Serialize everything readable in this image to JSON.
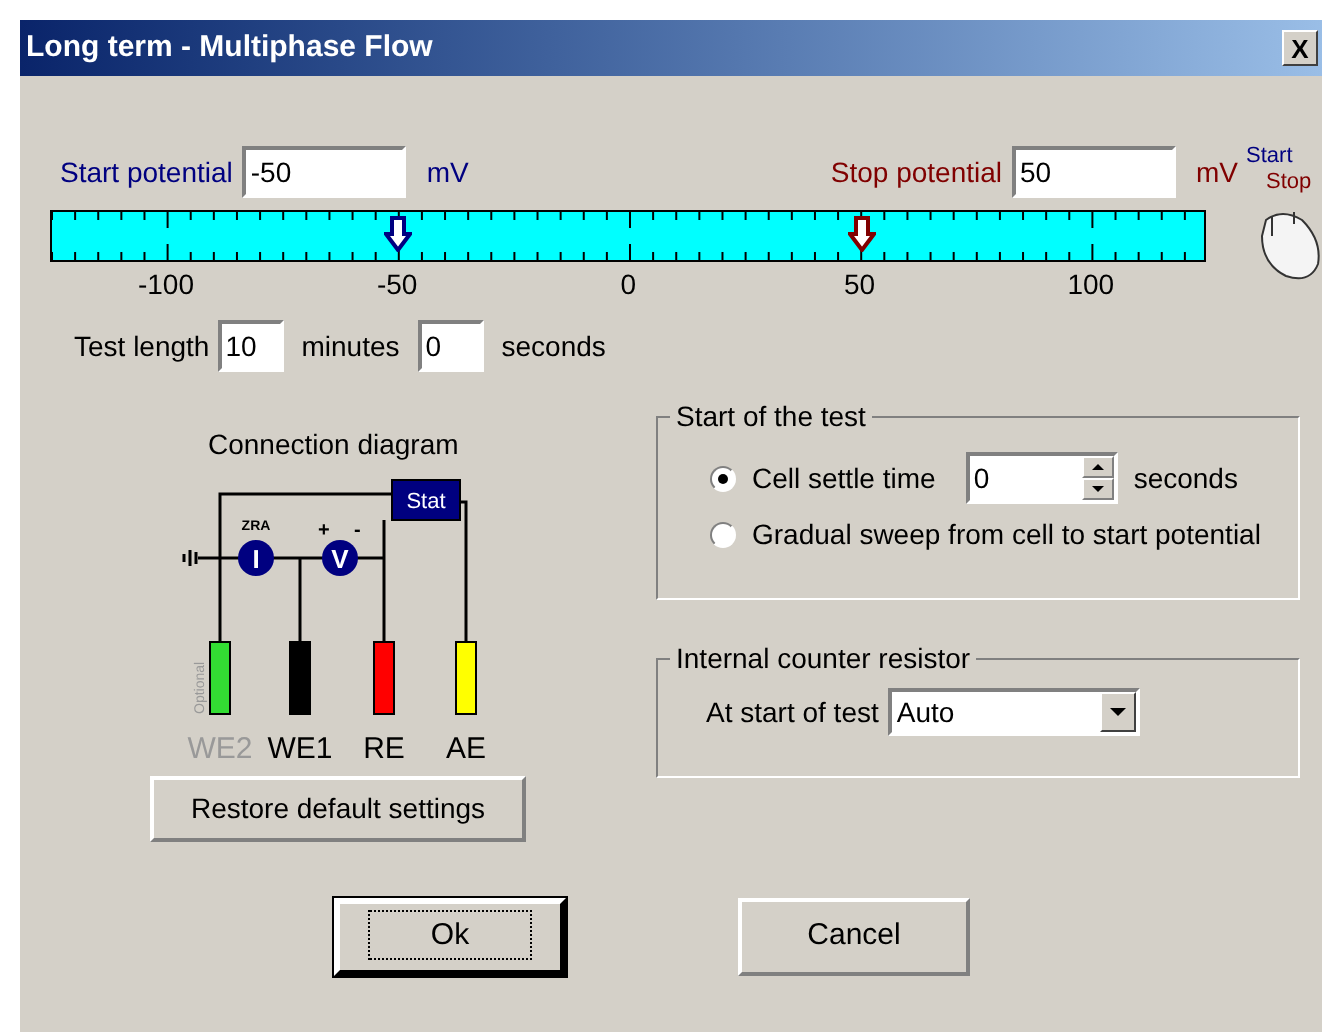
{
  "window": {
    "title": "Long term - Multiphase Flow",
    "close": "X"
  },
  "start_potential": {
    "label": "Start potential",
    "value": "-50",
    "unit": "mV"
  },
  "stop_potential": {
    "label": "Stop potential",
    "value": "50",
    "unit": "mV"
  },
  "scale": {
    "labels": [
      "-100",
      "-50",
      "0",
      "50",
      "100"
    ],
    "start_marker": {
      "level": 0.3
    },
    "stop_marker": {
      "level": 0.7
    }
  },
  "mouse_hint": {
    "start": "Start",
    "stop": "Stop"
  },
  "test_length": {
    "label": "Test length",
    "minutes": "10",
    "minutes_unit": "minutes",
    "seconds": "0",
    "seconds_unit": "seconds"
  },
  "connection_diagram": {
    "title": "Connection diagram",
    "stat": "Stat",
    "zra": "ZRA",
    "current": "I",
    "voltage": "V",
    "plus": "+",
    "minus": "-",
    "optional": "Optional",
    "electrodes": [
      {
        "label": "WE2",
        "color": "#33dd33",
        "optional": true
      },
      {
        "label": "WE1",
        "color": "#000000",
        "optional": false
      },
      {
        "label": "RE",
        "color": "#ff0000",
        "optional": false
      },
      {
        "label": "AE",
        "color": "#ffff00",
        "optional": false
      }
    ]
  },
  "restore_button": "Restore default settings",
  "start_of_test": {
    "title": "Start of the test",
    "options": [
      {
        "kind": "spin",
        "label": "Cell settle time",
        "selected": true,
        "value": "0",
        "unit": "seconds"
      },
      {
        "kind": "plain",
        "label": "Gradual sweep from cell to start potential",
        "selected": false
      }
    ]
  },
  "counter_resistor": {
    "title": "Internal counter resistor",
    "label": "At start of test",
    "value": "Auto"
  },
  "buttons": [
    {
      "label": "Ok",
      "focused": true
    },
    {
      "label": "Cancel",
      "focused": false
    }
  ]
}
